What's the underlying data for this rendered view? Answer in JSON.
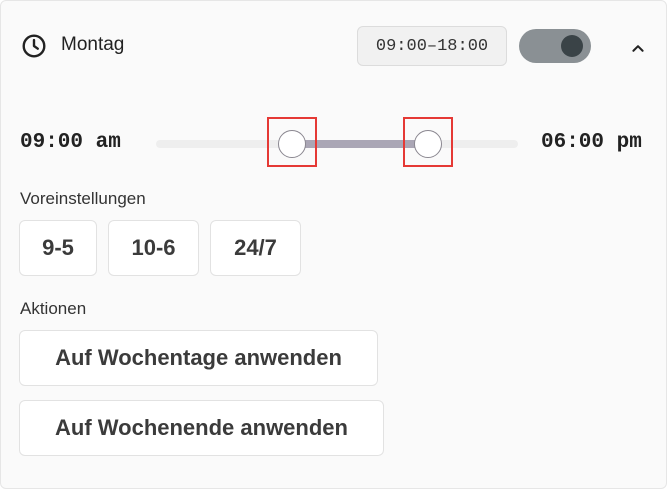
{
  "day": {
    "label": "Montag",
    "clock_icon": "clock-icon",
    "range_text": "09:00–18:00",
    "enabled": true,
    "expanded": true,
    "collapse_icon": "chevron-up-icon"
  },
  "slider": {
    "start_label": "09:00 am",
    "end_label": "06:00 pm",
    "start_fraction": 0.375,
    "end_fraction": 0.75
  },
  "presets": {
    "heading": "Voreinstellungen",
    "items": [
      "9-5",
      "10-6",
      "24/7"
    ]
  },
  "actions": {
    "heading": "Aktionen",
    "weekdays": "Auf Wochentage anwenden",
    "weekend": "Auf Wochenende anwenden"
  },
  "colors": {
    "toggle_on": "#8a9094",
    "range_fill": "#aaa6b5",
    "highlight": "#e53935"
  }
}
